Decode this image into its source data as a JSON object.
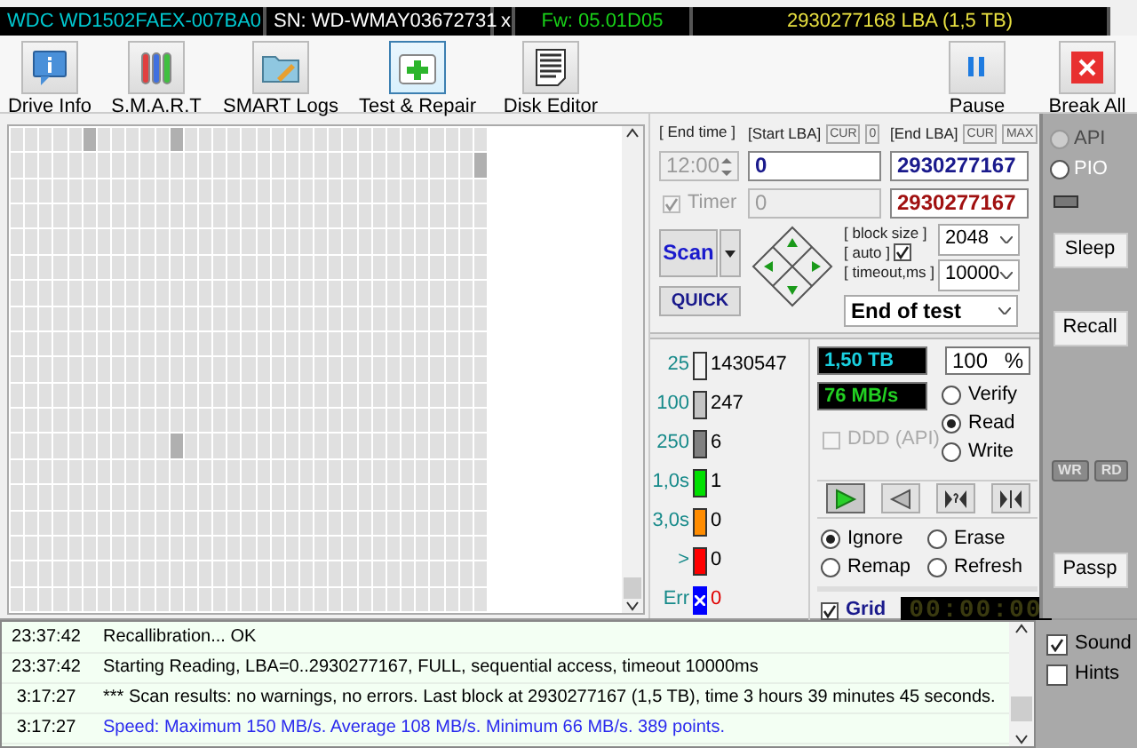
{
  "drive_bar": {
    "model": "WDC WD1502FAEX-007BA0",
    "serial": "SN: WD-WMAY03672731",
    "close": "x",
    "firmware": "Fw: 05.01D05",
    "capacity": "2930277168 LBA (1,5 TB)"
  },
  "toolbar": {
    "left": [
      {
        "label": "Drive Info",
        "kind": "info",
        "selected": false
      },
      {
        "label": "S.M.A.R.T",
        "kind": "smart",
        "selected": false
      },
      {
        "label": "SMART Logs",
        "kind": "logs",
        "selected": false
      },
      {
        "label": "Test & Repair",
        "kind": "repair",
        "selected": true
      },
      {
        "label": "Disk Editor",
        "kind": "editor",
        "selected": false
      }
    ],
    "right": [
      {
        "label": "Pause",
        "kind": "pause",
        "selected": false
      },
      {
        "label": "Break All",
        "kind": "break",
        "selected": false
      }
    ]
  },
  "range": {
    "end_time_label": "[ End time ]",
    "end_time": "12:00",
    "start_label": "[Start LBA]",
    "start_cur": "CUR",
    "start_zero": "0",
    "start_lba": "0",
    "start_current": "0",
    "end_label": "[End LBA]",
    "end_cur": "CUR",
    "end_max": "MAX",
    "end_lba": "2930277167",
    "end_current": "2930277167"
  },
  "timer": {
    "label": "Timer",
    "checked": true,
    "disabled": true
  },
  "scan": {
    "button": "Scan",
    "quick": "QUICK"
  },
  "block": {
    "size_label": "[ block size ]",
    "auto_label": "[ auto ]",
    "auto_checked": true,
    "size": "2048",
    "timeout_label": "[ timeout,ms ]",
    "timeout": "10000",
    "end_action": "End of test"
  },
  "legend": [
    {
      "kind": "block",
      "threshold": "25",
      "count": "1430547",
      "color": "#f2f2f2"
    },
    {
      "kind": "block",
      "threshold": "100",
      "count": "247",
      "color": "#c4c4c4"
    },
    {
      "kind": "block",
      "threshold": "250",
      "count": "6",
      "color": "#808080"
    },
    {
      "kind": "block",
      "threshold": "1,0s",
      "count": "1",
      "color": "#00e000"
    },
    {
      "kind": "block",
      "threshold": "3,0s",
      "count": "0",
      "color": "#ff8c00"
    },
    {
      "kind": "block",
      "threshold": ">",
      "count": "0",
      "color": "#ff0000"
    },
    {
      "kind": "error",
      "threshold": "Err",
      "count": "0",
      "color": "#0000ff"
    }
  ],
  "readouts": {
    "size": "1,50 TB",
    "percent": "100",
    "percent_sign": "%",
    "speed": "76 MB/s"
  },
  "ddd": {
    "label": "DDD (API)",
    "checked": false,
    "disabled": true
  },
  "modes": [
    {
      "label": "Verify",
      "selected": false
    },
    {
      "label": "Read",
      "selected": true
    },
    {
      "label": "Write",
      "selected": false
    }
  ],
  "transport": [
    {
      "kind": "play",
      "selected": true
    },
    {
      "kind": "reverse",
      "selected": false
    },
    {
      "kind": "seek",
      "selected": false
    },
    {
      "kind": "end",
      "selected": false
    }
  ],
  "actions": [
    {
      "label": "Ignore",
      "selected": true
    },
    {
      "label": "Erase",
      "selected": false
    },
    {
      "label": "Remap",
      "selected": false
    },
    {
      "label": "Refresh",
      "selected": false
    }
  ],
  "grid_option": {
    "label": "Grid",
    "checked": true
  },
  "elapsed": "00:00:00",
  "side": {
    "interfaces": [
      {
        "label": "API",
        "selected": false,
        "disabled": true
      },
      {
        "label": "PIO",
        "selected": false,
        "disabled": false
      }
    ],
    "sleep": "Sleep",
    "recall": "Recall",
    "wr": "WR",
    "rd": "RD",
    "passp": "Passp"
  },
  "log": [
    {
      "time": "23:37:42",
      "text": "Recallibration... OK",
      "kind": "normal"
    },
    {
      "time": "23:37:42",
      "text": "Starting Reading, LBA=0..2930277167, FULL, sequential access, timeout 10000ms",
      "kind": "normal"
    },
    {
      "time": "3:17:27",
      "text": "*** Scan results: no warnings, no errors. Last block at 2930277167 (1,5 TB), time 3 hours 39 minutes 45 seconds.",
      "kind": "normal"
    },
    {
      "time": "3:17:27",
      "text": "Speed: Maximum 150 MB/s. Average 108 MB/s. Minimum 66 MB/s. 389 points.",
      "kind": "info"
    }
  ],
  "options": [
    {
      "label": "Sound",
      "checked": true
    },
    {
      "label": "Hints",
      "checked": false
    }
  ]
}
